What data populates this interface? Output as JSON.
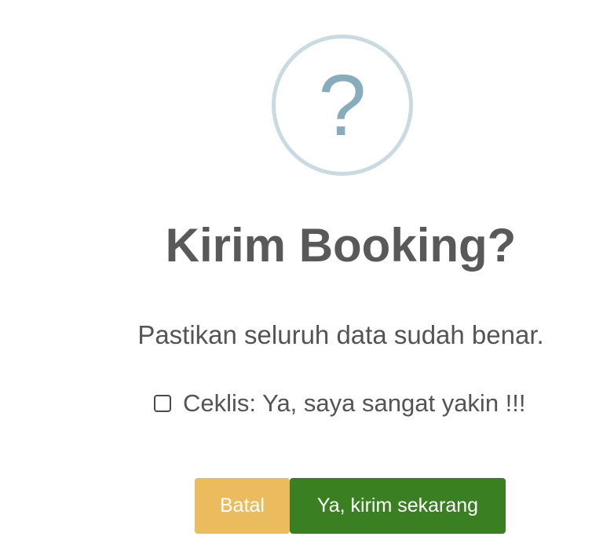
{
  "dialog": {
    "icon": {
      "name": "question-icon",
      "glyph": "?",
      "ring_color": "#c9dae1",
      "glyph_color": "#87adbd"
    },
    "title": "Kirim Booking?",
    "message": "Pastikan seluruh data sudah benar.",
    "confirmation": {
      "checked": false,
      "label": "Ceklis: Ya, saya sangat yakin !!!"
    },
    "buttons": {
      "cancel_label": "Batal",
      "cancel_color": "#ebbc5e",
      "confirm_label": "Ya, kirim sekarang",
      "confirm_color": "#3a7f22"
    }
  }
}
